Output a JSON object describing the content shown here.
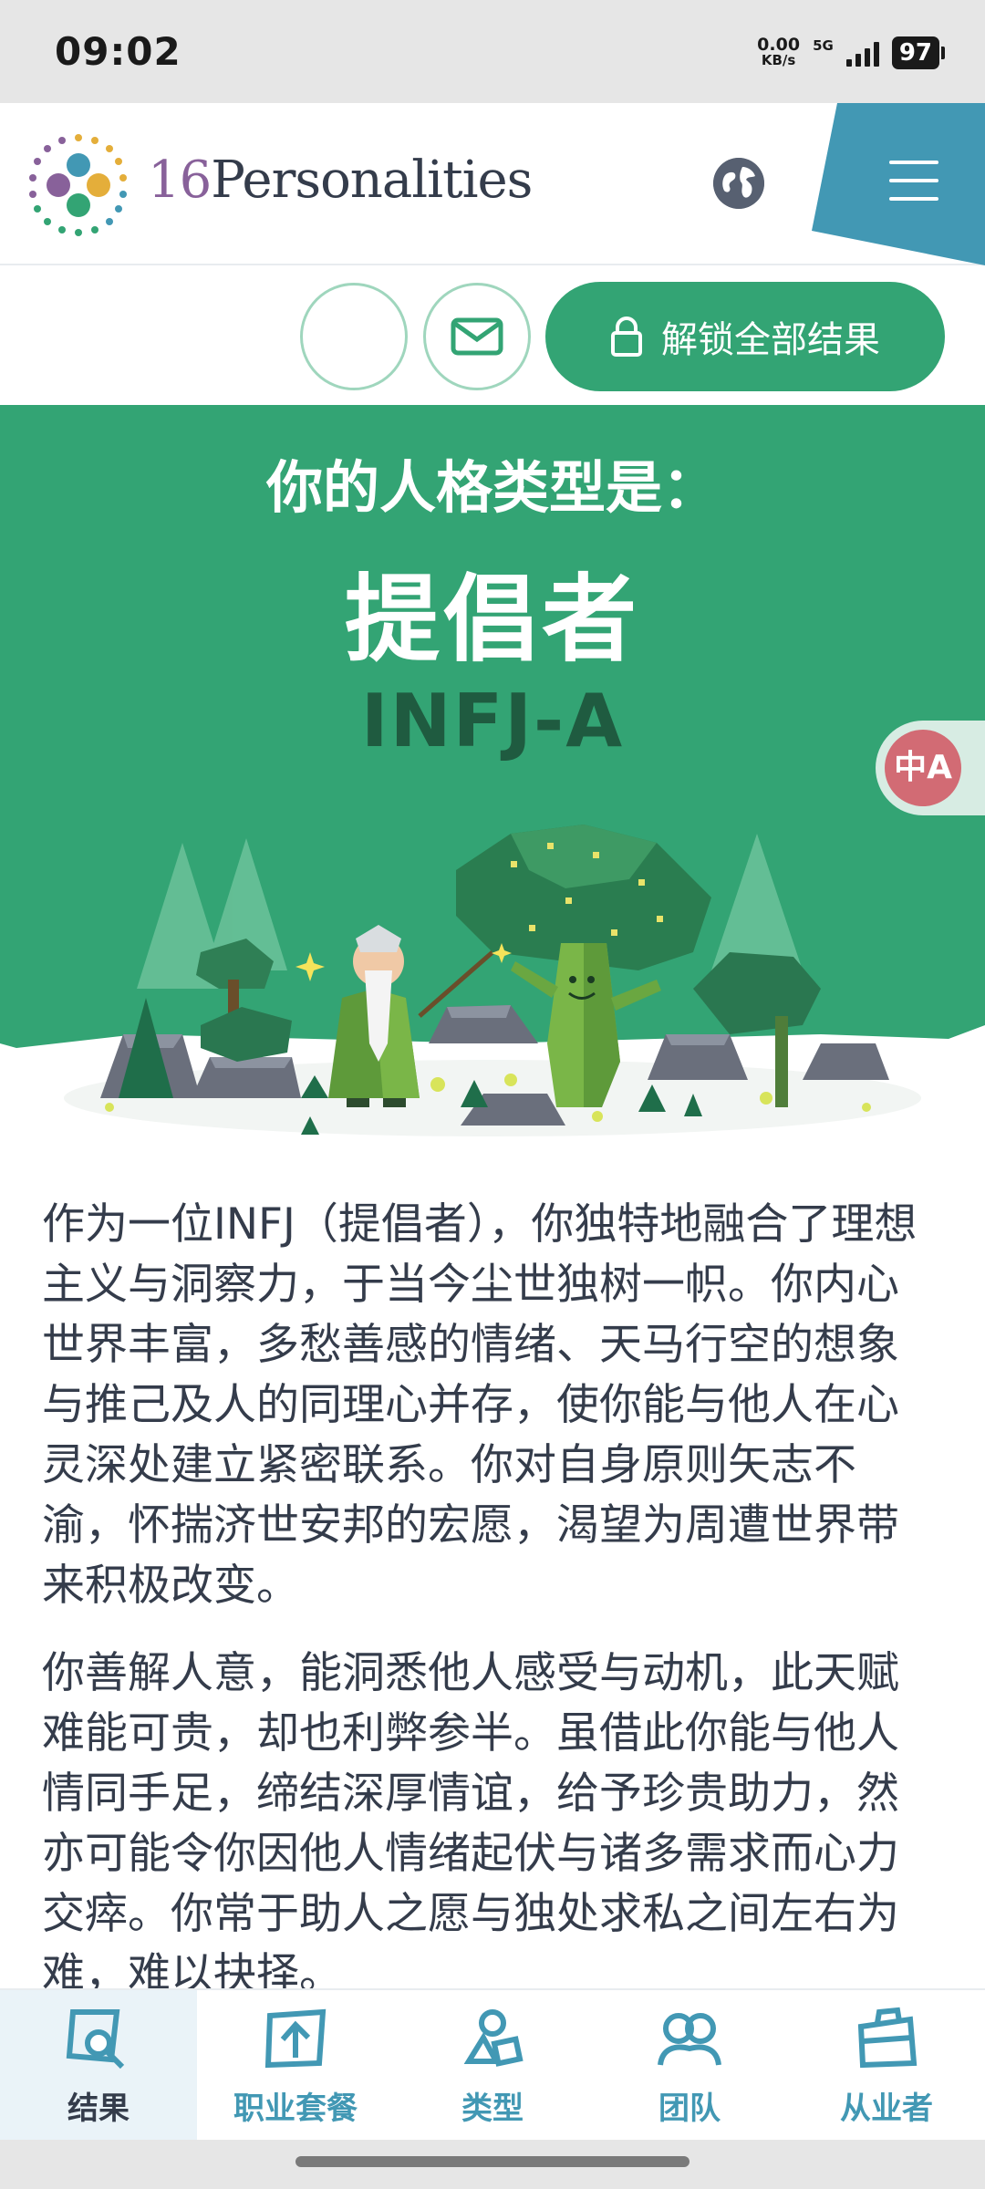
{
  "status_bar": {
    "time": "09:02",
    "speed_value": "0.00",
    "speed_unit": "KB/s",
    "network": "5G",
    "battery": "97"
  },
  "header": {
    "brand_number": "16",
    "brand_name": "Personalities",
    "globe_icon": "globe-icon",
    "menu_icon": "hamburger-menu-icon"
  },
  "actions": {
    "share_icon": "blank",
    "mail_icon": "mail-icon",
    "unlock_label": "解锁全部结果",
    "unlock_icon": "lock-icon"
  },
  "hero": {
    "subtitle": "你的人格类型是：",
    "title": "提倡者",
    "code": "INFJ-A",
    "translate_icon": "translate-icon"
  },
  "article": {
    "paragraphs": [
      "作为一位INFJ（提倡者），你独特地融合了理想主义与洞察力，于当今尘世独树一帜。你内心世界丰富，多愁善感的情绪、天马行空的想象与推己及人的同理心并存，使你能与他人在心灵深处建立紧密联系。你对自身原则矢志不渝，怀揣济世安邦的宏愿，渴望为周遭世界带来积极改变。",
      "你善解人意，能洞悉他人感受与动机，此天赋难能可贵，却也利弊参半。虽借此你能与他人情同手足，缔结深厚情谊，给予珍贵助力，然亦可能令你因他人情绪起伏与诸多需求而心力交瘁。你常于助人之愿与独处求私之间左右为难，难以抉择。"
    ]
  },
  "bottom_nav": {
    "items": [
      {
        "label": "结果",
        "icon": "results-icon",
        "active": true
      },
      {
        "label": "职业套餐",
        "icon": "career-icon",
        "active": false
      },
      {
        "label": "类型",
        "icon": "types-icon",
        "active": false
      },
      {
        "label": "团队",
        "icon": "team-icon",
        "active": false
      },
      {
        "label": "从业者",
        "icon": "professional-icon",
        "active": false
      }
    ]
  },
  "colors": {
    "brand_green": "#33a474",
    "brand_blue": "#4298b4",
    "text_dark": "#343c4b",
    "hero_code": "#1f5b40"
  }
}
